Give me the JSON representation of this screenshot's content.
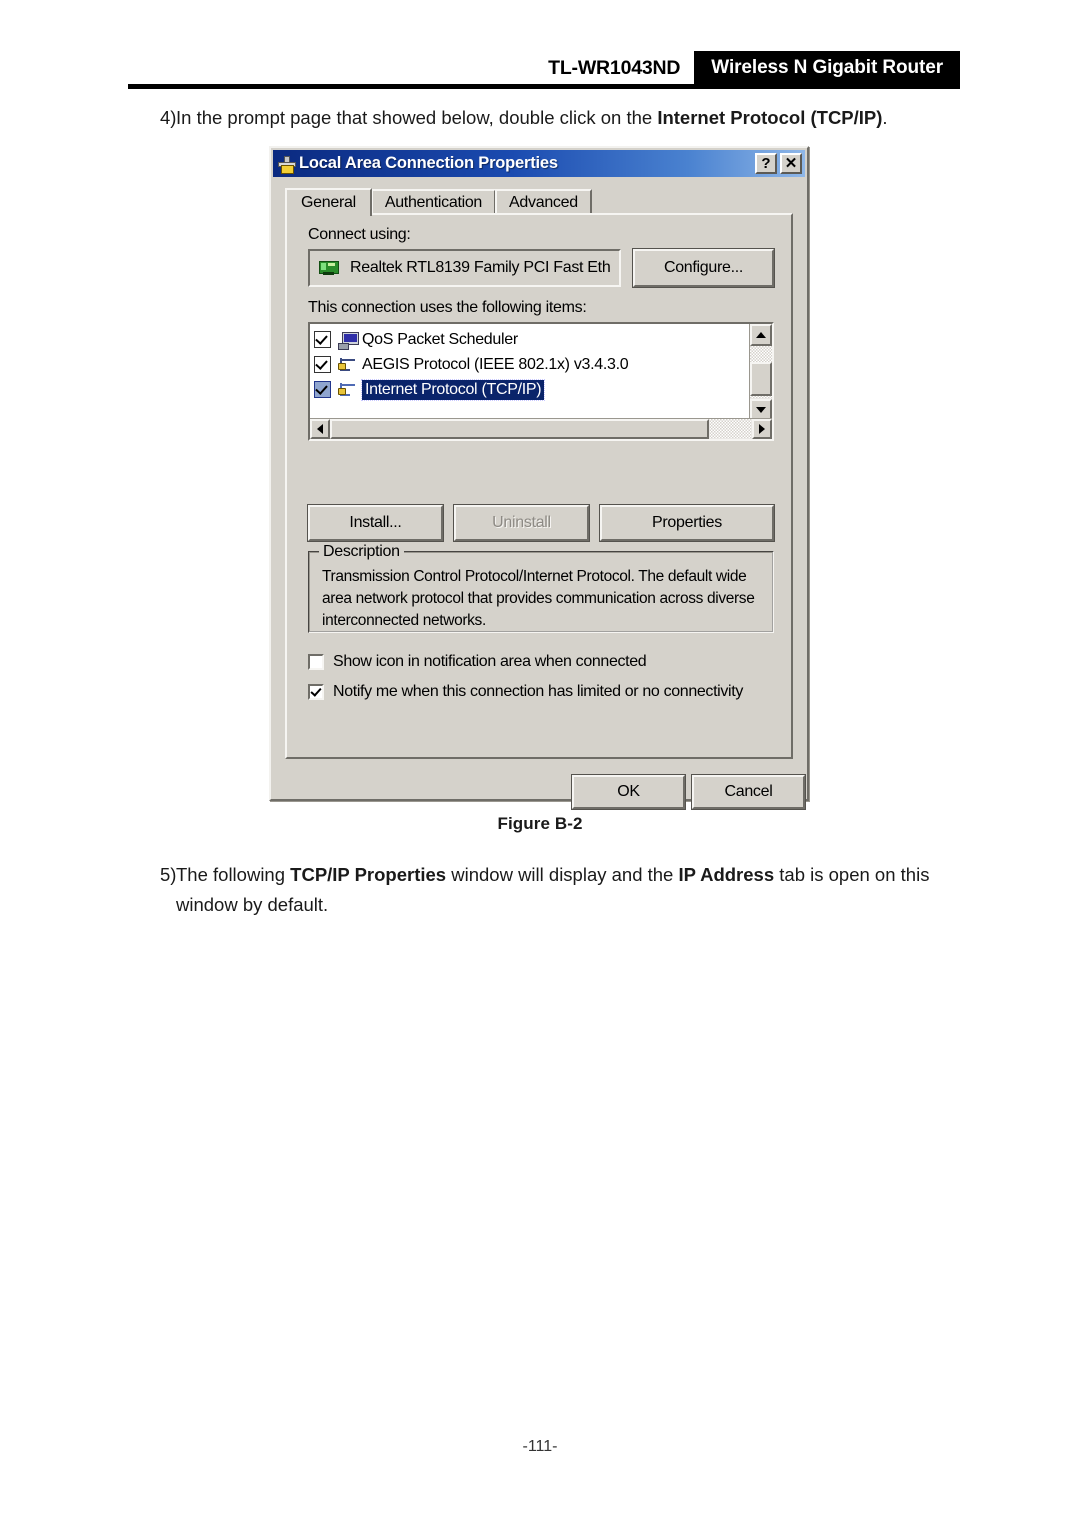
{
  "header": {
    "model": "TL-WR1043ND",
    "badge": "Wireless N Gigabit Router"
  },
  "steps": {
    "step4": {
      "number": "4)",
      "text_before": "In the prompt page that showed below, double click on the ",
      "text_bold": "Internet Protocol (TCP/IP)",
      "text_after": "."
    },
    "step5": {
      "number": "5)",
      "part1": "The following ",
      "bold1": "TCP/IP Properties",
      "part2": " window will display and the ",
      "bold2": "IP Address",
      "part3": " tab is open on this window by default."
    }
  },
  "figure_caption": "Figure B-2",
  "footer": "-111-",
  "dialog": {
    "title": "Local Area Connection   Properties",
    "title_icon": "network-connection-icon",
    "help_button": "?",
    "close_button": "✕",
    "tabs": [
      {
        "label": "General",
        "active": true
      },
      {
        "label": "Authentication",
        "active": false
      },
      {
        "label": "Advanced",
        "active": false
      }
    ],
    "connect_using_label": "Connect using:",
    "adapter": {
      "icon": "network-adapter-icon",
      "name": "Realtek RTL8139 Family PCI Fast Eth"
    },
    "configure_button": "Configure...",
    "items_label": "This connection uses the following items:",
    "items": [
      {
        "label": "QoS Packet Scheduler",
        "checked": true,
        "selected": false,
        "icon": "computer-icon"
      },
      {
        "label": "AEGIS Protocol (IEEE 802.1x) v3.4.3.0",
        "checked": true,
        "selected": false,
        "icon": "protocol-icon"
      },
      {
        "label": "Internet Protocol (TCP/IP)",
        "checked": true,
        "selected": true,
        "icon": "protocol-icon"
      }
    ],
    "buttons": {
      "install": "Install...",
      "uninstall": "Uninstall",
      "properties": "Properties"
    },
    "description": {
      "title": "Description",
      "body": "Transmission Control Protocol/Internet Protocol. The default wide area network protocol that provides communication across diverse interconnected networks."
    },
    "checkboxes": [
      {
        "label": "Show icon in notification area when connected",
        "checked": false
      },
      {
        "label": "Notify me when this connection has limited or no connectivity",
        "checked": true
      }
    ],
    "ok_button": "OK",
    "cancel_button": "Cancel"
  },
  "colors": {
    "dialog_face": "#d5d2cb",
    "titlebar_start": "#0b2a80",
    "titlebar_end": "#8fb7e8",
    "selection": "#0a246a",
    "badge_bg": "#000000"
  }
}
